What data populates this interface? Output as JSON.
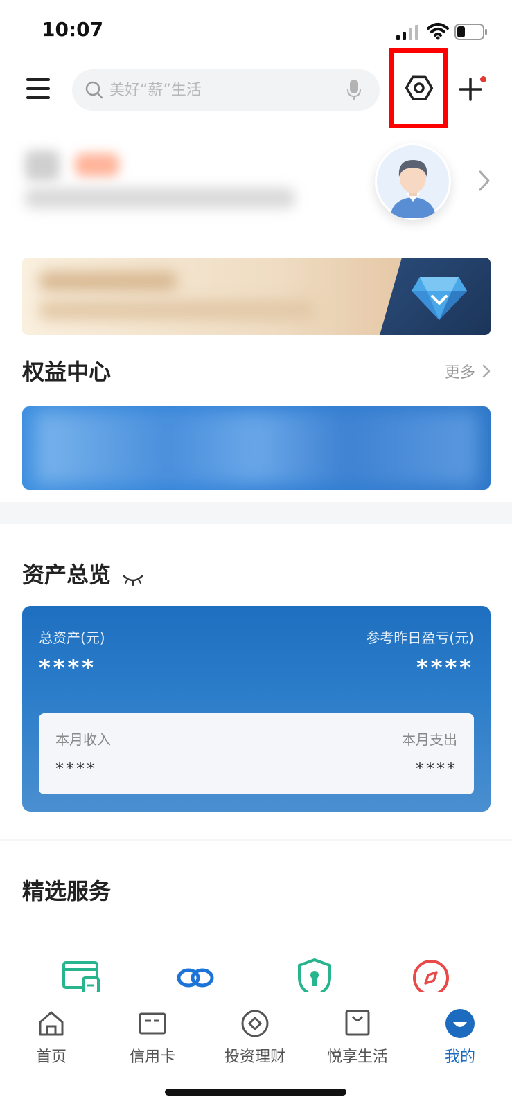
{
  "status_bar": {
    "time": "10:07"
  },
  "header": {
    "search_placeholder": "美好“薪”生活"
  },
  "rights_center": {
    "title": "权益中心",
    "more": "更多"
  },
  "assets": {
    "title": "资产总览",
    "total_label": "总资产(元)",
    "total_value": "****",
    "yesterday_label": "参考昨日盈亏(元)",
    "yesterday_value": "****",
    "income_label": "本月收入",
    "income_value": "****",
    "expense_label": "本月支出",
    "expense_value": "****"
  },
  "services": {
    "title": "精选服务"
  },
  "tabs": [
    {
      "label": "首页",
      "icon": "home-icon"
    },
    {
      "label": "信用卡",
      "icon": "credit-card-icon"
    },
    {
      "label": "投资理财",
      "icon": "investment-icon"
    },
    {
      "label": "悦享生活",
      "icon": "shopping-bag-icon"
    },
    {
      "label": "我的",
      "icon": "profile-icon",
      "active": true
    }
  ],
  "colors": {
    "accent": "#1d6bbf",
    "highlight": "#ff0000",
    "badge": "#e53935"
  }
}
